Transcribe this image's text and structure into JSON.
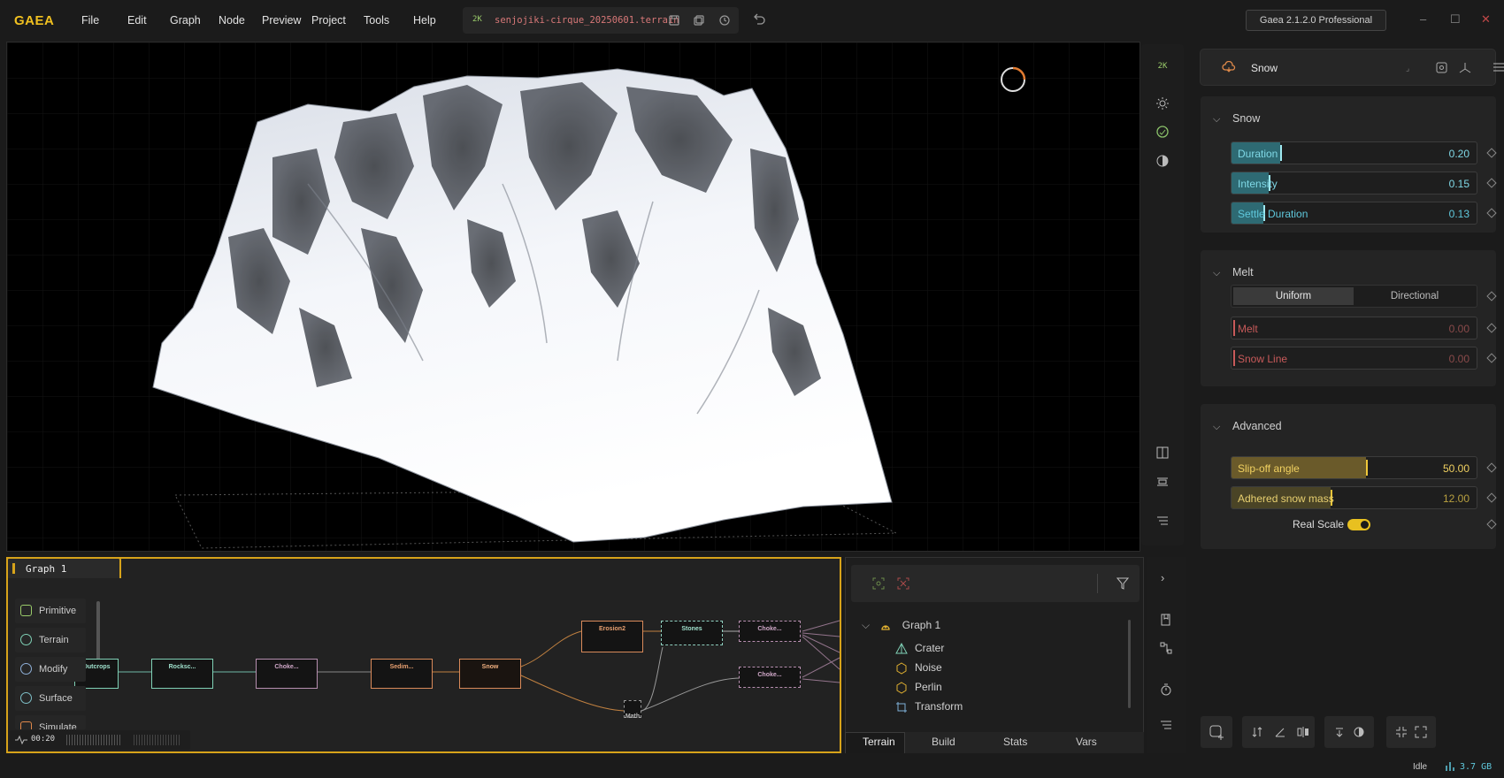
{
  "app": {
    "logo": "GAEA",
    "version": "Gaea 2.1.2.0 Professional",
    "status": "Idle",
    "memory": "3.7 GB"
  },
  "menu": [
    "File",
    "Edit",
    "Graph",
    "Node",
    "Preview",
    "Project",
    "Tools",
    "Help"
  ],
  "file": {
    "badge": "2K",
    "name": "senjojiki-cirque_20250601.terrain"
  },
  "viewport": {
    "resolution_badge": "2K"
  },
  "properties": {
    "node_name": "Snow",
    "snow": {
      "title": "Snow",
      "duration": {
        "label": "Duration",
        "value": "0.20",
        "level": 0.2
      },
      "intensity": {
        "label": "Intensity",
        "value": "0.15",
        "level": 0.15
      },
      "settle": {
        "label": "Settle Duration",
        "value": "0.13",
        "level": 0.13
      }
    },
    "melt": {
      "title": "Melt",
      "mode_options": [
        "Uniform",
        "Directional"
      ],
      "mode_selected": "Uniform",
      "melt": {
        "label": "Melt",
        "value": "0.00",
        "level": 0
      },
      "snow_line": {
        "label": "Snow Line",
        "value": "0.00",
        "level": 0
      }
    },
    "advanced": {
      "title": "Advanced",
      "slip_off": {
        "label": "Slip-off angle",
        "value": "50.00",
        "level": 0.5
      },
      "adhered": {
        "label": "Adhered snow mass",
        "value": "12.00",
        "level": 0.36
      },
      "real_scale": {
        "label": "Real Scale",
        "on": true
      }
    }
  },
  "graph": {
    "tab": "Graph 1",
    "palette": [
      "Primitive",
      "Terrain",
      "Modify",
      "Surface",
      "Simulate"
    ],
    "timer": "00:20",
    "nodes": [
      "Outcrops",
      "Rocksc...",
      "Choke...",
      "Sedim...",
      "Snow",
      "Erosion2",
      "Stones",
      "Choke...",
      "Choke...",
      "Math"
    ]
  },
  "outliner": {
    "root": "Graph 1",
    "items": [
      "Crater",
      "Noise",
      "Perlin",
      "Transform"
    ]
  },
  "tabs": [
    "Terrain",
    "Build",
    "Stats",
    "Vars"
  ],
  "colors": {
    "accent": "#d7a31a",
    "cyan": "#5fd3e0",
    "red": "#c85a5a",
    "yellow": "#e8c43a",
    "teal": "#7fd0b5",
    "orange": "#d98a5a"
  }
}
